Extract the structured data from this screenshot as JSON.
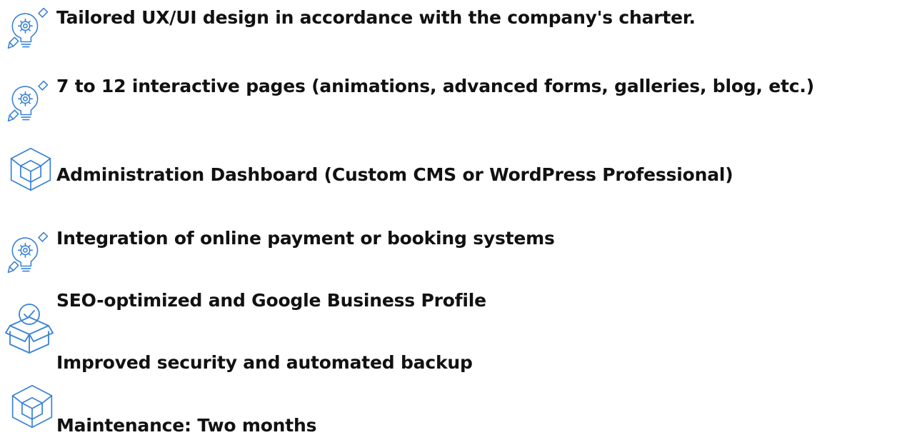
{
  "features": [
    {
      "icon": "lightbulb-gear-icon",
      "text": "Tailored UX/UI design in accordance with the company's charter."
    },
    {
      "icon": "lightbulb-gear-icon",
      "text": "7 to 12 interactive pages (animations, advanced forms, galleries, blog, etc.)"
    },
    {
      "icon": "cube-icon",
      "text": "Administration Dashboard (Custom CMS or WordPress Professional)"
    },
    {
      "icon": "lightbulb-gear-icon",
      "text": "Integration of online payment or booking systems"
    },
    {
      "icon": "verified-box-icon",
      "text": "SEO-optimized and Google Business Profile"
    },
    {
      "icon": "",
      "text": "Improved security and automated backup"
    },
    {
      "icon": "cube-icon",
      "text": "Maintenance: Two months"
    }
  ],
  "colors": {
    "text": "#111111",
    "icon_stroke": "#3a82d6"
  }
}
